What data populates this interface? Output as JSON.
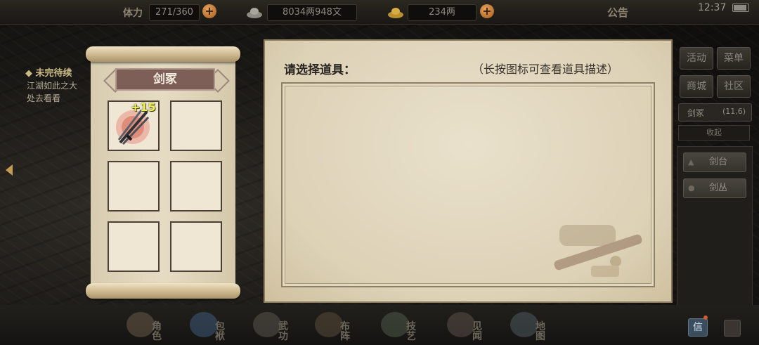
{
  "topbar": {
    "stamina_label": "体力",
    "stamina_value": "271/360",
    "money_value": "8034两948文",
    "gold_value": "234两",
    "announcement": "公告",
    "time": "12:37"
  },
  "quest": {
    "title": "◆ 未完待续",
    "line1": "江湖如此之大",
    "line2": "处去看看"
  },
  "scroll": {
    "name": "剑冢",
    "item_badge": "+15"
  },
  "main": {
    "title": "请选择道具：",
    "hint": "（长按图标可查看道具描述）"
  },
  "right": {
    "buttons": [
      "活动",
      "菜单",
      "商城",
      "社区"
    ],
    "panel_title": "剑冢",
    "panel_count": "(11,6)",
    "panel_sub": "收起",
    "items": [
      "剑台",
      "剑丛"
    ]
  },
  "bottom": {
    "nav": [
      "角色",
      "包袱",
      "武功",
      "布阵",
      "技艺",
      "见闻",
      "地图"
    ],
    "mail": "信"
  },
  "colors": {
    "accent": "#c29a55",
    "badge": "#f0f05c",
    "plate": "#7d5f57"
  },
  "icons": {
    "stamina": "stamina-icon",
    "money": "silver-ingot-icon",
    "gold": "gold-ingot-icon",
    "sword_item": "sword-bundle-icon"
  }
}
